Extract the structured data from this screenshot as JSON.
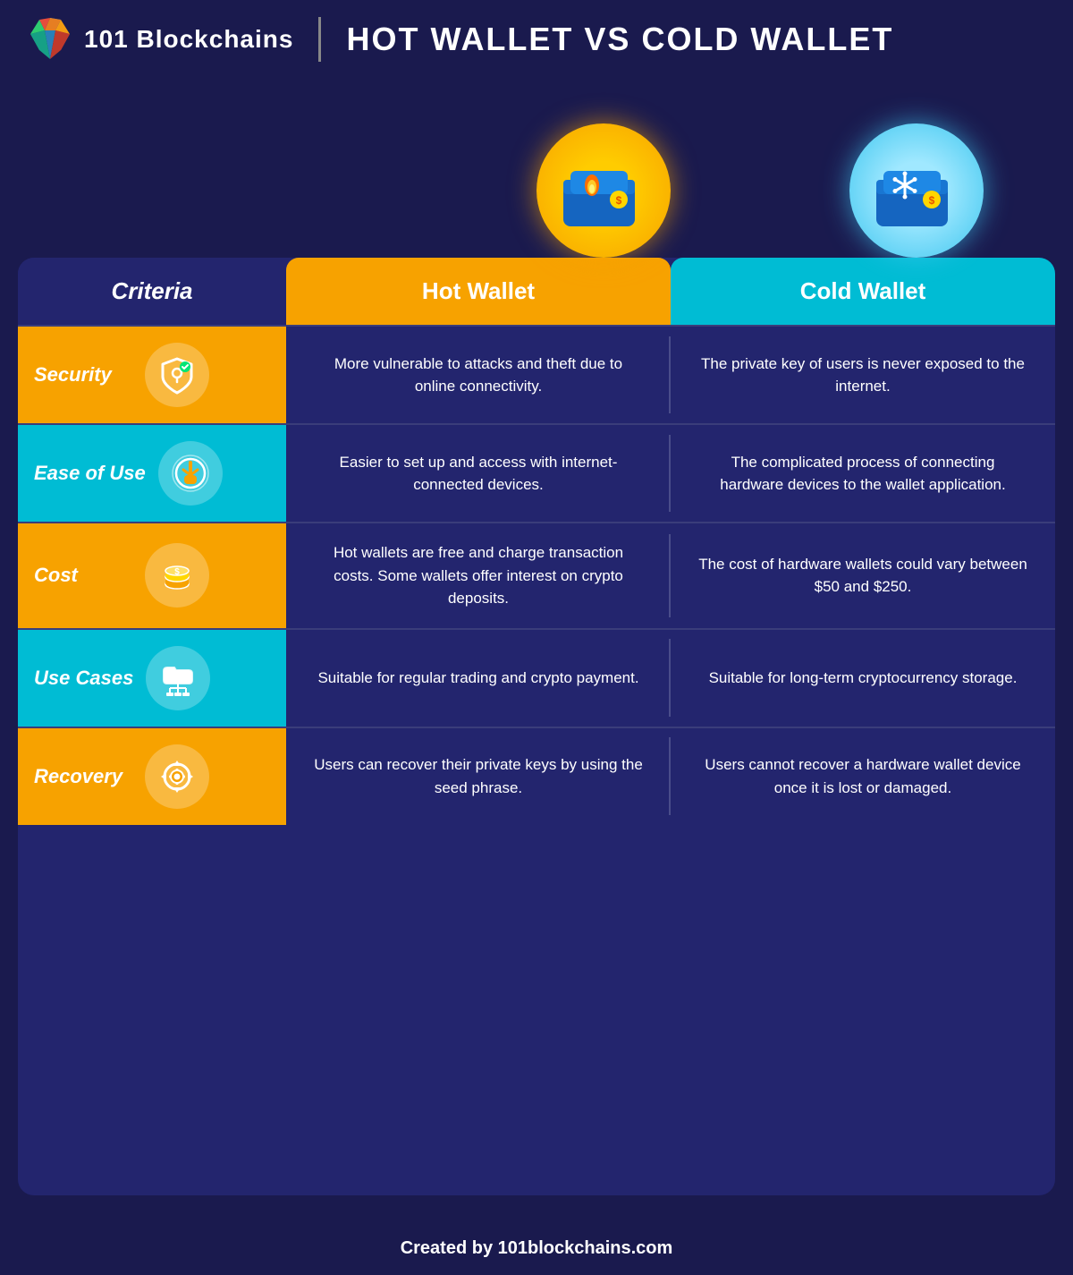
{
  "header": {
    "logo_text": "101 Blockchains",
    "title": "HOT WALLET VS COLD WALLET",
    "divider": true
  },
  "wallets": {
    "hot": {
      "label": "Hot Wallet",
      "icon": "🔥",
      "circle_type": "hot"
    },
    "cold": {
      "label": "Cold Wallet",
      "icon": "❄️",
      "circle_type": "cold"
    }
  },
  "columns": {
    "criteria": "Criteria",
    "hot": "Hot Wallet",
    "cold": "Cold Wallet"
  },
  "rows": [
    {
      "id": "security",
      "label": "Security",
      "icon": "shield",
      "hot_text": "More vulnerable to attacks and theft due to online connectivity.",
      "cold_text": "The private key of users is never exposed to the internet.",
      "color": "orange"
    },
    {
      "id": "ease-of-use",
      "label": "Ease of Use",
      "icon": "hand",
      "hot_text": "Easier to set up and access with internet-connected devices.",
      "cold_text": "The complicated process of connecting hardware devices to the wallet application.",
      "color": "cyan"
    },
    {
      "id": "cost",
      "label": "Cost",
      "icon": "coins",
      "hot_text": "Hot wallets are free and charge transaction costs. Some wallets offer interest on crypto deposits.",
      "cold_text": "The cost of hardware wallets could vary between $50 and $250.",
      "color": "orange"
    },
    {
      "id": "use-cases",
      "label": "Use Cases",
      "icon": "folder",
      "hot_text": "Suitable for regular trading and crypto payment.",
      "cold_text": "Suitable for long-term cryptocurrency storage.",
      "color": "cyan"
    },
    {
      "id": "recovery",
      "label": "Recovery",
      "icon": "recycle",
      "hot_text": "Users can recover their private keys by using the seed phrase.",
      "cold_text": "Users cannot recover a hardware wallet device once it is lost or damaged.",
      "color": "orange"
    }
  ],
  "footer": {
    "text": "Created by 101blockchains.com"
  }
}
